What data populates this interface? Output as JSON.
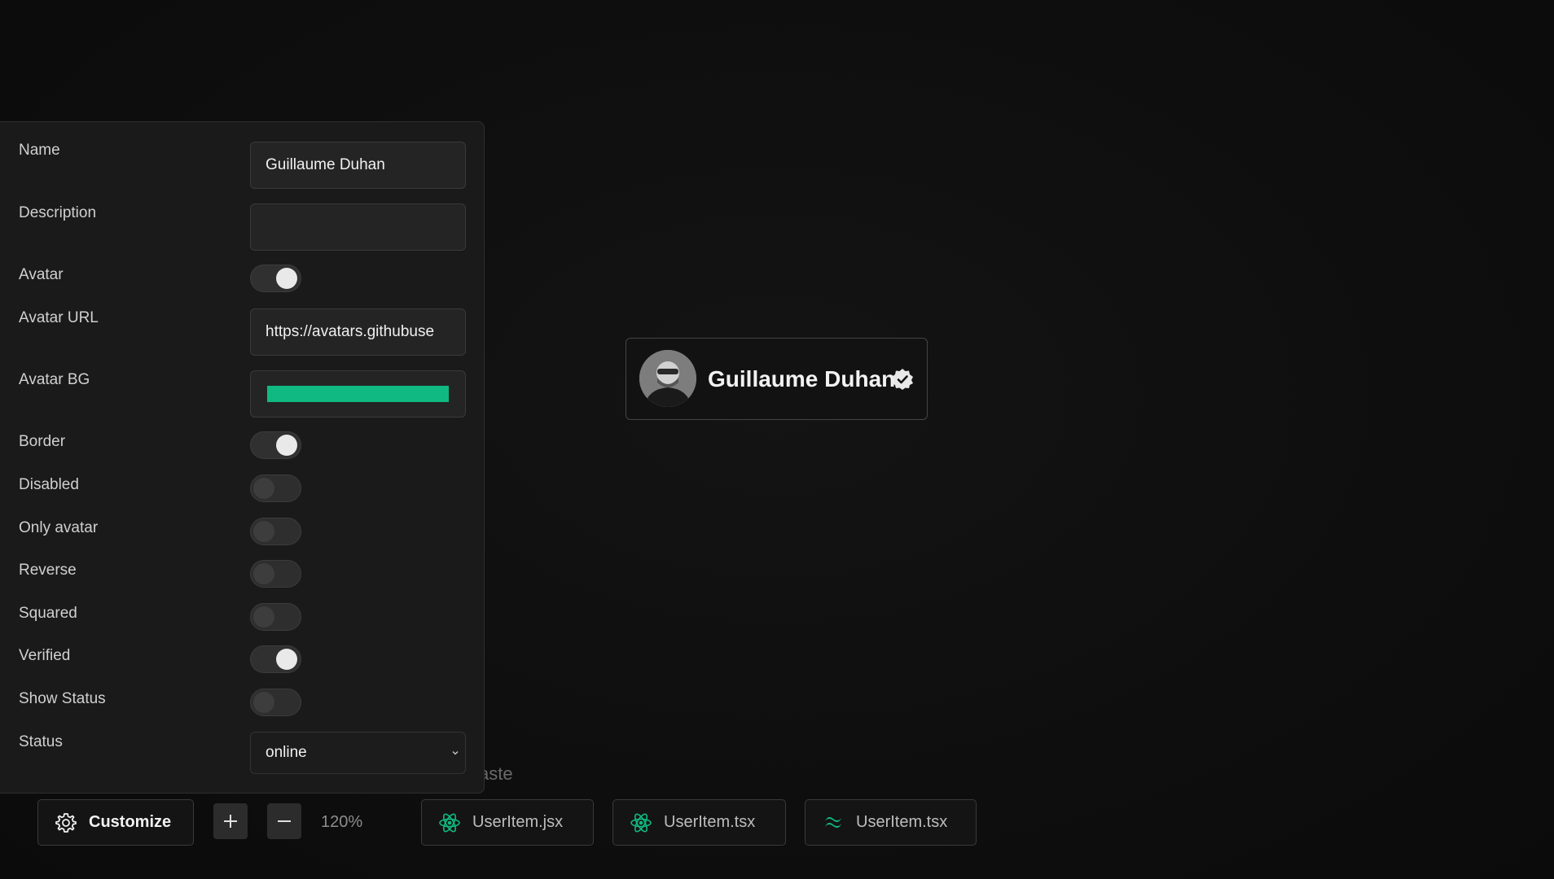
{
  "panel": {
    "fields": {
      "name": {
        "label": "Name",
        "value": "Guillaume Duhan"
      },
      "description": {
        "label": "Description",
        "value": ""
      },
      "avatar": {
        "label": "Avatar",
        "on": true
      },
      "avatar_url": {
        "label": "Avatar URL",
        "value": "https://avatars.githubuse"
      },
      "avatar_bg": {
        "label": "Avatar BG",
        "color": "#10b981"
      },
      "border": {
        "label": "Border",
        "on": true
      },
      "disabled": {
        "label": "Disabled",
        "on": false
      },
      "only_avatar": {
        "label": "Only avatar",
        "on": false
      },
      "reverse": {
        "label": "Reverse",
        "on": false
      },
      "squared": {
        "label": "Squared",
        "on": false
      },
      "verified": {
        "label": "Verified",
        "on": true
      },
      "show_status": {
        "label": "Show Status",
        "on": false
      },
      "status": {
        "label": "Status",
        "value": "online"
      }
    }
  },
  "preview": {
    "name": "Guillaume Duhan",
    "avatar_icon": "user-photo",
    "verified_icon": "verified-badge-icon"
  },
  "occluded_text": "aste",
  "toolbar": {
    "customize_label": "Customize",
    "zoom_level": "120%",
    "files": [
      {
        "label": "UserItem.jsx",
        "icon": "react-icon"
      },
      {
        "label": "UserItem.tsx",
        "icon": "react-icon"
      },
      {
        "label": "UserItem.tsx",
        "icon": "tailwind-icon"
      }
    ]
  },
  "colors": {
    "accent": "#10b981",
    "background": "#101010",
    "panel": "#1a1a1a"
  }
}
